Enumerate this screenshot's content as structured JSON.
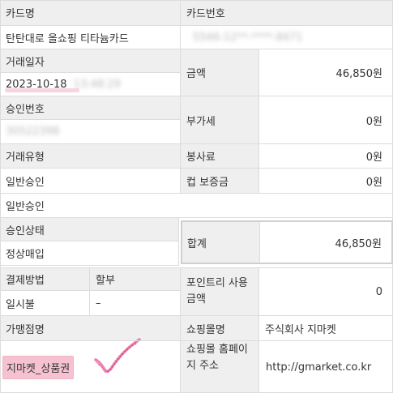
{
  "receipt": {
    "card_name_label": "카드명",
    "card_number_label": "카드번호",
    "card_name_value": "탄탄대로 올쇼핑 티타늄카드",
    "card_number_value": "5546-12**-****-8471",
    "transaction_date_label": "거래일자",
    "transaction_date_value": "2023-10-18",
    "transaction_time_value": "13:48:29",
    "amount_label": "금액",
    "amount_value": "46,850원",
    "approval_no_label": "승인번호",
    "approval_no_value": "30522398",
    "vat_label": "부가세",
    "vat_value": "0원",
    "transaction_type_label": "거래유형",
    "service_fee_label": "봉사료",
    "service_fee_value": "0원",
    "transaction_type_value": "일반승인",
    "cup_deposit_label": "컵 보증금",
    "cup_deposit_value": "0원",
    "transaction_type_value_2": "일반승인",
    "approval_status_label": "승인상태",
    "total_label": "합계",
    "total_value": "46,850원",
    "approval_status_value": "정상매입",
    "payment_method_label": "결제방법",
    "installment_label": "할부",
    "payment_method_value": "일시불",
    "installment_value": "–",
    "points_label": "포인트리 사용금액",
    "points_value": "0",
    "merchant_label": "가맹점명",
    "mall_name_label": "쇼핑몰명",
    "mall_name_value": "주식회사 지마켓",
    "merchant_value": "지마켓_상품권",
    "mall_url_label": "쇼핑몰 홈페이지 주소",
    "mall_url_value": "http://gmarket.co.kr"
  }
}
